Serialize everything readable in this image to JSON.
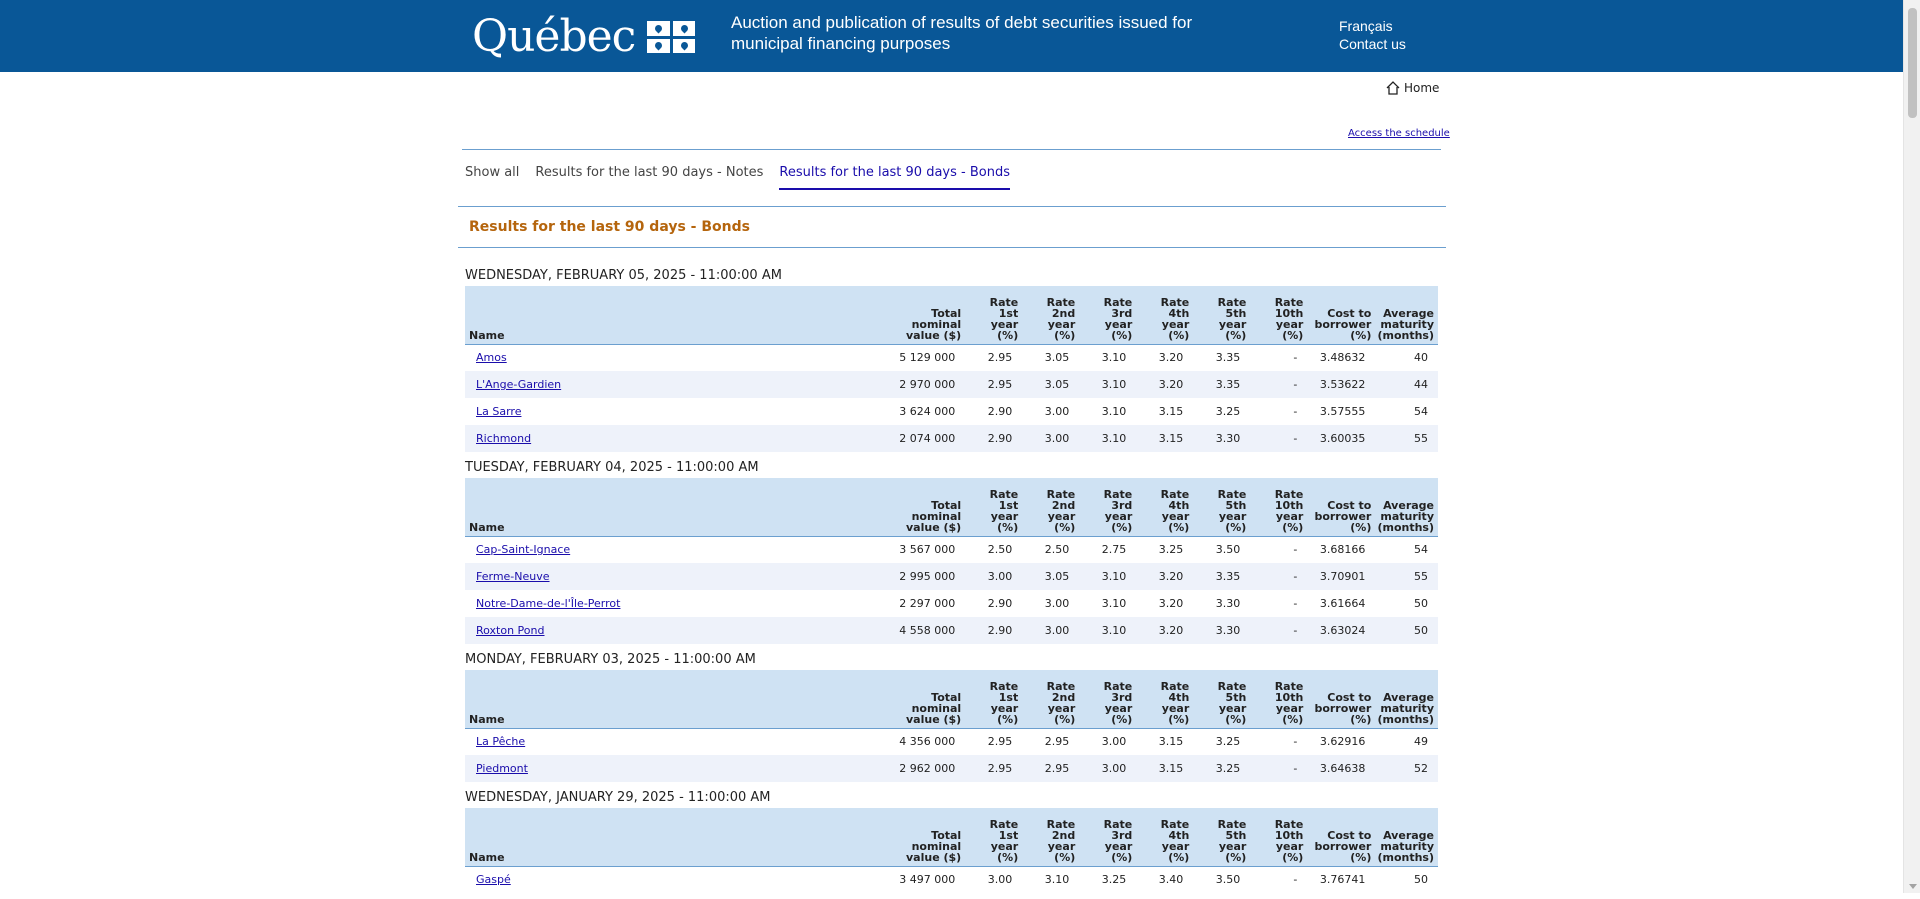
{
  "header": {
    "logo_text": "Québec",
    "site_title": "Auction and publication of results of debt securities issued for municipal financing purposes",
    "lang_link": "Français",
    "contact_link": "Contact us"
  },
  "nav": {
    "home": "Home",
    "schedule": "Access the schedule"
  },
  "tabs": [
    {
      "label": "Show all",
      "active": false
    },
    {
      "label": "Results for the last 90 days - Notes",
      "active": false
    },
    {
      "label": "Results for the last 90 days - Bonds",
      "active": true
    }
  ],
  "section_title": "Results for the last 90 days - Bonds",
  "columns": {
    "name": "Name",
    "total": [
      "Total",
      "nominal",
      "value ($)"
    ],
    "r1": [
      "Rate",
      "1st",
      "year",
      "(%)"
    ],
    "r2": [
      "Rate",
      "2nd",
      "year",
      "(%)"
    ],
    "r3": [
      "Rate",
      "3rd",
      "year",
      "(%)"
    ],
    "r4": [
      "Rate",
      "4th",
      "year",
      "(%)"
    ],
    "r5": [
      "Rate",
      "5th",
      "year",
      "(%)"
    ],
    "r10": [
      "Rate",
      "10th",
      "year",
      "(%)"
    ],
    "cost": [
      "Cost to",
      "borrower",
      "(%)"
    ],
    "avg": [
      "Average",
      "maturity",
      "(months)"
    ]
  },
  "auctions": [
    {
      "date": "WEDNESDAY, FEBRUARY 05, 2025 - 11:00:00 AM",
      "rows": [
        [
          "Amos",
          "5 129 000",
          "2.95",
          "3.05",
          "3.10",
          "3.20",
          "3.35",
          "-",
          "3.48632",
          "40"
        ],
        [
          "L'Ange-Gardien",
          "2 970 000",
          "2.95",
          "3.05",
          "3.10",
          "3.20",
          "3.35",
          "-",
          "3.53622",
          "44"
        ],
        [
          "La Sarre",
          "3 624 000",
          "2.90",
          "3.00",
          "3.10",
          "3.15",
          "3.25",
          "-",
          "3.57555",
          "54"
        ],
        [
          "Richmond",
          "2 074 000",
          "2.90",
          "3.00",
          "3.10",
          "3.15",
          "3.30",
          "-",
          "3.60035",
          "55"
        ]
      ]
    },
    {
      "date": "TUESDAY, FEBRUARY 04, 2025 - 11:00:00 AM",
      "rows": [
        [
          "Cap-Saint-Ignace",
          "3 567 000",
          "2.50",
          "2.50",
          "2.75",
          "3.25",
          "3.50",
          "-",
          "3.68166",
          "54"
        ],
        [
          "Ferme-Neuve",
          "2 995 000",
          "3.00",
          "3.05",
          "3.10",
          "3.20",
          "3.35",
          "-",
          "3.70901",
          "55"
        ],
        [
          "Notre-Dame-de-l'Île-Perrot",
          "2 297 000",
          "2.90",
          "3.00",
          "3.10",
          "3.20",
          "3.30",
          "-",
          "3.61664",
          "50"
        ],
        [
          "Roxton Pond",
          "4 558 000",
          "2.90",
          "3.00",
          "3.10",
          "3.20",
          "3.30",
          "-",
          "3.63024",
          "50"
        ]
      ]
    },
    {
      "date": "MONDAY, FEBRUARY 03, 2025 - 11:00:00 AM",
      "rows": [
        [
          "La Pêche",
          "4 356 000",
          "2.95",
          "2.95",
          "3.00",
          "3.15",
          "3.25",
          "-",
          "3.62916",
          "49"
        ],
        [
          "Piedmont",
          "2 962 000",
          "2.95",
          "2.95",
          "3.00",
          "3.15",
          "3.25",
          "-",
          "3.64638",
          "52"
        ]
      ]
    },
    {
      "date": "WEDNESDAY, JANUARY 29, 2025 - 11:00:00 AM",
      "rows": [
        [
          "Gaspé",
          "3 497 000",
          "3.00",
          "3.10",
          "3.25",
          "3.40",
          "3.50",
          "-",
          "3.76741",
          "50"
        ]
      ]
    }
  ]
}
